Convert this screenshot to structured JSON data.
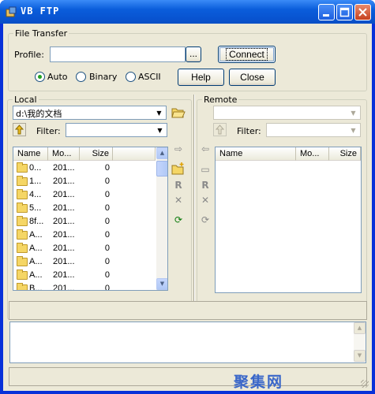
{
  "window": {
    "title": "VB FTP"
  },
  "transfer": {
    "group_label": "File Transfer",
    "profile_label": "Profile:",
    "profile_value": "",
    "browse_label": "...",
    "connect_label": "Connect",
    "mode_auto": "Auto",
    "mode_binary": "Binary",
    "mode_ascii": "ASCII",
    "mode_selected": "Auto",
    "help_label": "Help",
    "close_label": "Close"
  },
  "local": {
    "group_label": "Local",
    "path": "d:\\我的文档",
    "filter_label": "Filter:",
    "filter_value": "",
    "columns": [
      "Name",
      "Mo...",
      "Size"
    ],
    "rows": [
      {
        "name": "0...",
        "modified": "201...",
        "size": "0"
      },
      {
        "name": "1...",
        "modified": "201...",
        "size": "0"
      },
      {
        "name": "4...",
        "modified": "201...",
        "size": "0"
      },
      {
        "name": "5...",
        "modified": "201...",
        "size": "0"
      },
      {
        "name": "8f...",
        "modified": "201...",
        "size": "0"
      },
      {
        "name": "A...",
        "modified": "201...",
        "size": "0"
      },
      {
        "name": "A...",
        "modified": "201...",
        "size": "0"
      },
      {
        "name": "A...",
        "modified": "201...",
        "size": "0"
      },
      {
        "name": "A...",
        "modified": "201...",
        "size": "0"
      },
      {
        "name": "B...",
        "modified": "201...",
        "size": "0"
      }
    ]
  },
  "remote": {
    "group_label": "Remote",
    "path": "",
    "filter_label": "Filter:",
    "filter_value": "",
    "columns": [
      "Name",
      "Mo...",
      "Size"
    ]
  },
  "watermark": "聚集网",
  "colors": {
    "titlebar": "#0a5ddb",
    "face": "#ece9d8",
    "border": "#7f9db9"
  }
}
